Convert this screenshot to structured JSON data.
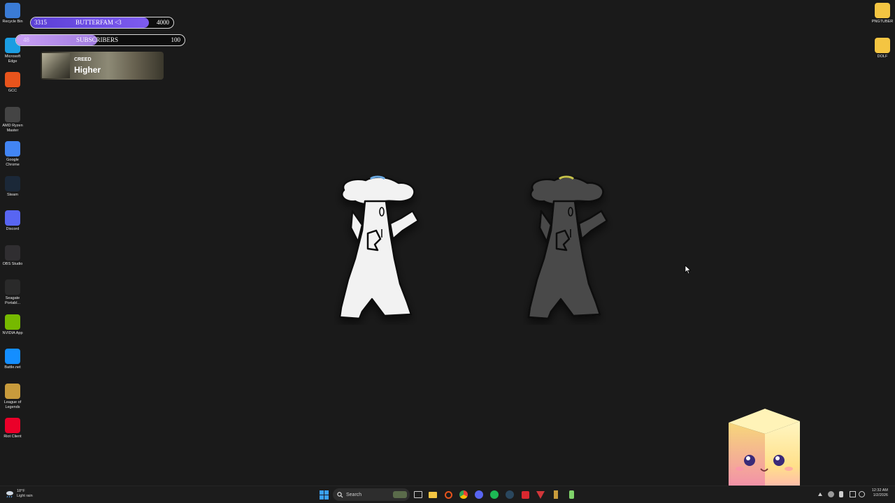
{
  "desktop_left": [
    {
      "label": "Recycle Bin",
      "icon": "recycle-bin-icon",
      "color": "#3a7bd5"
    },
    {
      "label": "Microsoft Edge",
      "icon": "edge-icon",
      "color": "#1b9de2"
    },
    {
      "label": "GCC",
      "icon": "gcc-icon",
      "color": "#e8541c"
    },
    {
      "label": "AMD Ryzen Master",
      "icon": "amd-ryzen-icon",
      "color": "#444444"
    },
    {
      "label": "Google Chrome",
      "icon": "chrome-icon",
      "color": "#4285f4"
    },
    {
      "label": "Steam",
      "icon": "steam-icon",
      "color": "#1b2838"
    },
    {
      "label": "Discord",
      "icon": "discord-icon",
      "color": "#5865f2"
    },
    {
      "label": "OBS Studio",
      "icon": "obs-icon",
      "color": "#302e31"
    },
    {
      "label": "Seagate Portabl...",
      "icon": "seagate-icon",
      "color": "#2a2a2a"
    },
    {
      "label": "NVIDIA App",
      "icon": "nvidia-icon",
      "color": "#76b900"
    },
    {
      "label": "Battle.net",
      "icon": "battlenet-icon",
      "color": "#148eff"
    },
    {
      "label": "League of Legends",
      "icon": "league-icon",
      "color": "#c89b3c"
    },
    {
      "label": "Riot Client",
      "icon": "riot-icon",
      "color": "#eb0029"
    }
  ],
  "desktop_right": [
    {
      "label": "PNGTUBER",
      "icon": "folder-icon",
      "color": "#f4c542"
    },
    {
      "label": "DOLF",
      "icon": "folder-icon",
      "color": "#f4c542"
    }
  ],
  "goal_follow": {
    "current": "3315",
    "label": "BUTTERFAM <3",
    "target": "4000",
    "progress": 0.83,
    "color": "#5b3fd6"
  },
  "goal_sub": {
    "current": "48",
    "label": "SUBSCRIBERS",
    "target": "100",
    "progress": 0.48,
    "color": "#c9a0f5"
  },
  "now_playing": {
    "artist": "CREED",
    "title": "Higher"
  },
  "taskbar": {
    "search_placeholder": "Search",
    "weather_temp": "18°F",
    "weather_desc": "Light rain",
    "time": "12:32 AM",
    "date": "1/2/2026"
  }
}
